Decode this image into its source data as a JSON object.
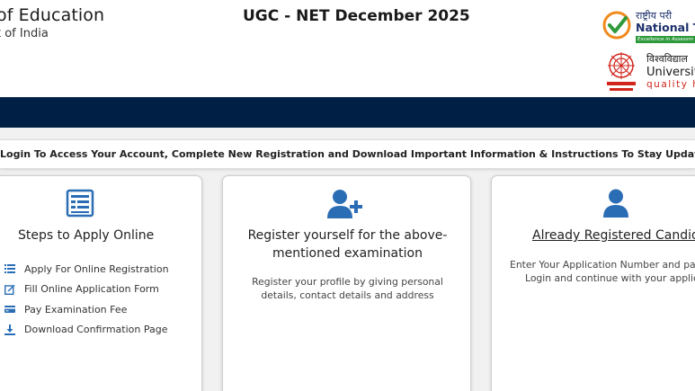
{
  "header": {
    "ministry_name": "of Education",
    "ministry_sub": "t of India",
    "exam_title": "UGC - NET December 2025",
    "nta_logo": {
      "hindi": "राष्ट्रीय परी",
      "english": "National T",
      "tagline": "Excellence in Assessm"
    },
    "ugc_logo": {
      "hindi": "विश्वविद्याल",
      "english": "University",
      "tagline": "quality hig"
    }
  },
  "notice": {
    "text": "Login To Access Your Account, Complete New Registration and Download Important Information & Instructions To Stay Updated."
  },
  "cards": {
    "steps": {
      "title": "Steps to Apply Online",
      "items": [
        {
          "label": "Apply For Online Registration",
          "icon": "list-icon"
        },
        {
          "label": "Fill Online Application Form",
          "icon": "edit-icon"
        },
        {
          "label": "Pay Examination Fee",
          "icon": "credit-card-icon"
        },
        {
          "label": "Download Confirmation Page",
          "icon": "download-icon"
        }
      ]
    },
    "register": {
      "title_line1": "Register yourself for the above-",
      "title_line2": "mentioned examination",
      "desc_line1": "Register your profile by giving personal",
      "desc_line2": "details, contact details and address"
    },
    "login": {
      "title": "Already Registered Candidate",
      "desc_line1": "Enter Your Application Number and passw",
      "desc_line2": "Login and continue with your applicatio"
    }
  },
  "colors": {
    "navbar": "#001f45",
    "icon_blue": "#2a6db5",
    "nta_green": "#2e9a3c",
    "ugc_red": "#d0261c"
  }
}
